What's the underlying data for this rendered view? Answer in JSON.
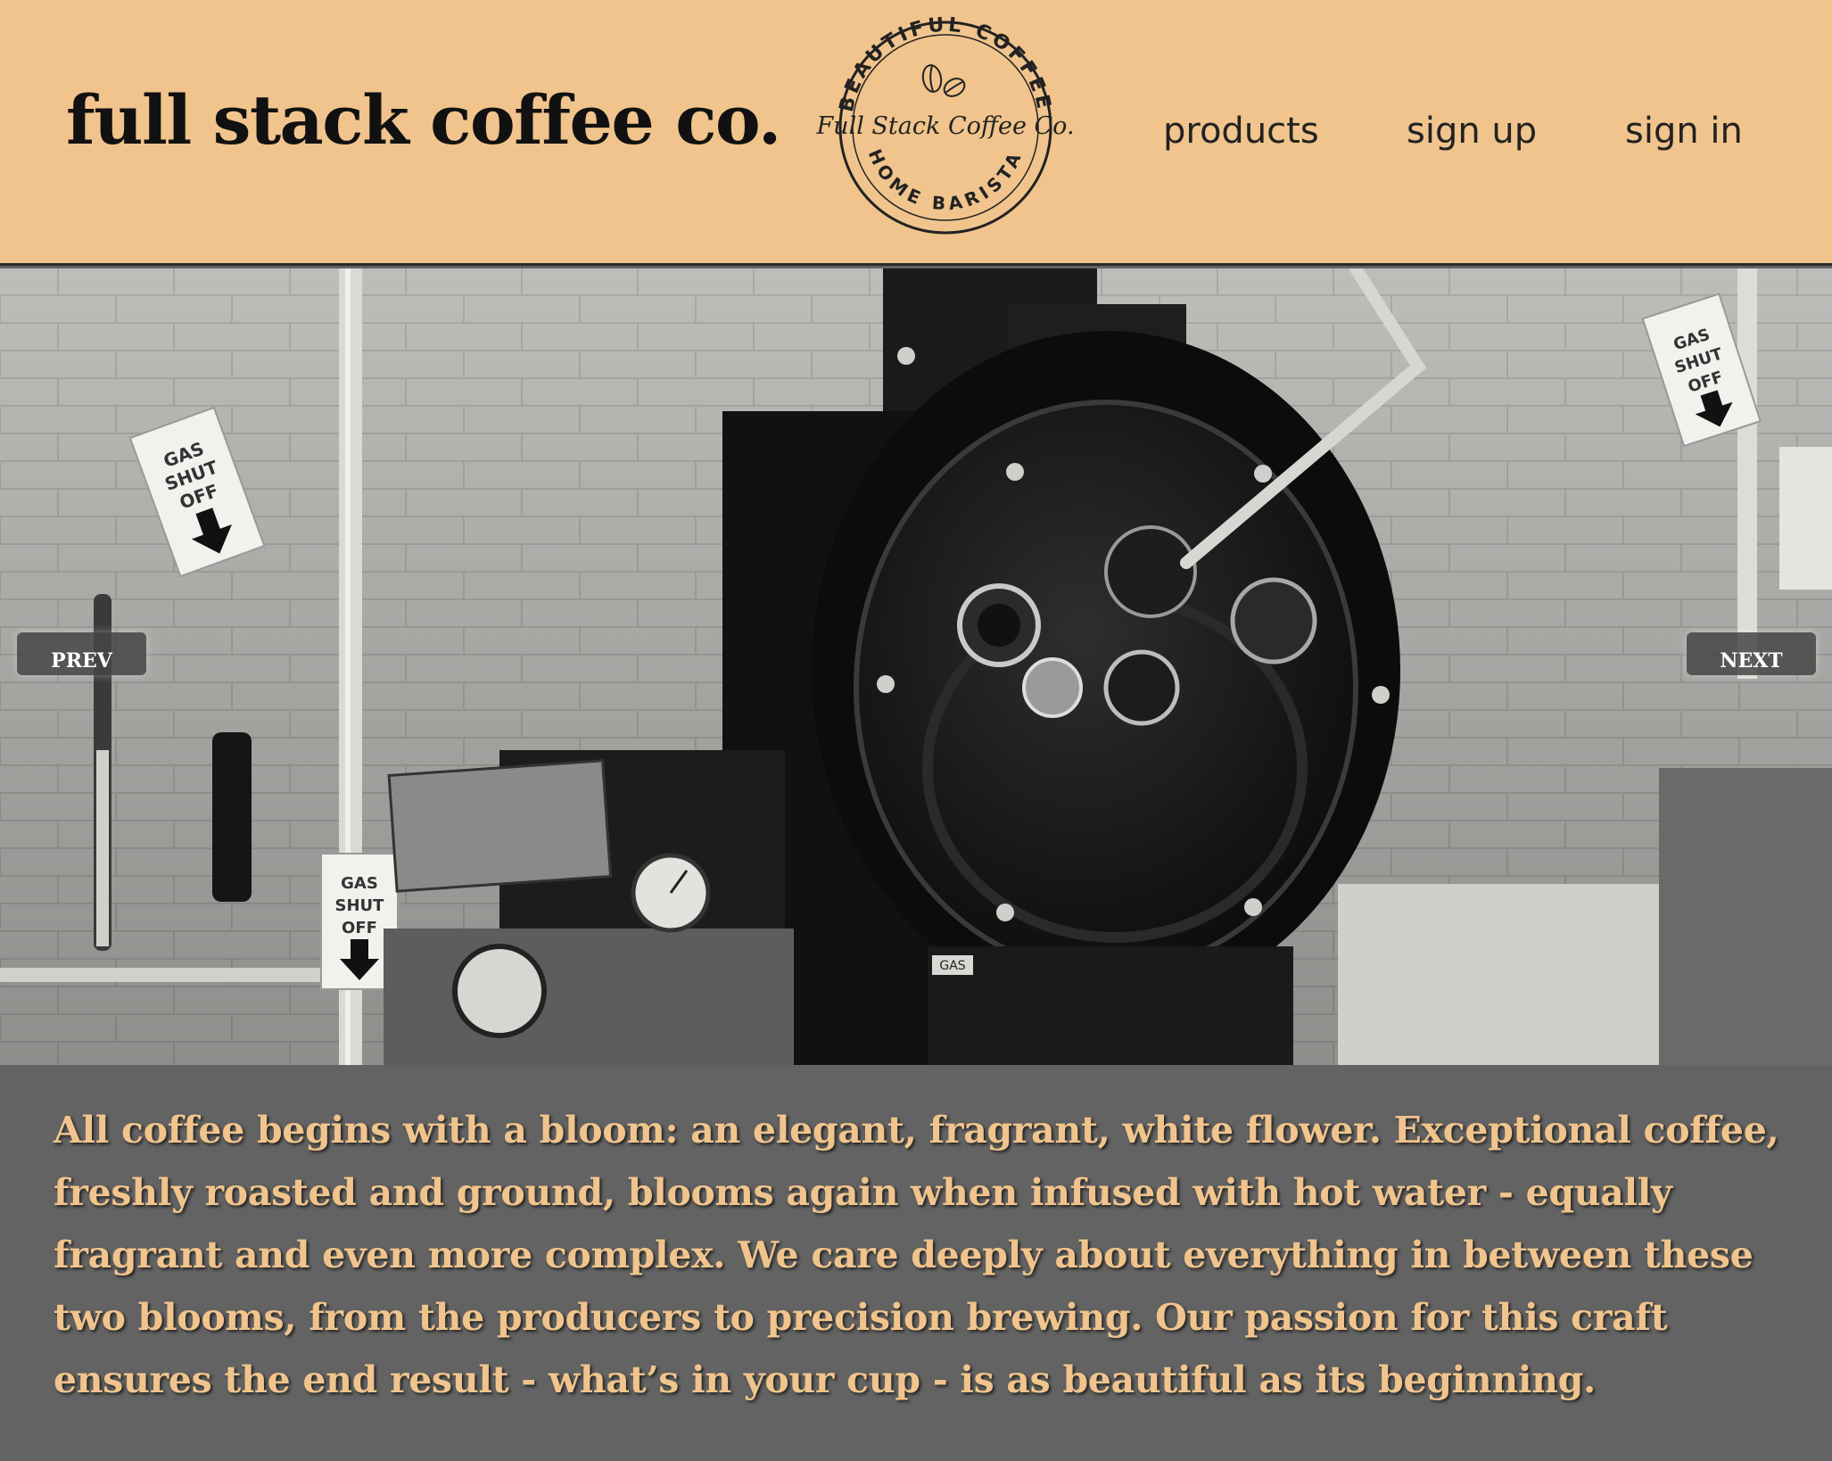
{
  "header": {
    "brand": "full stack coffee co.",
    "logo": {
      "top_text": "BEAUTIFUL COFFEE",
      "center_text": "Full Stack Coffee Co.",
      "bottom_text": "HOME BARISTA"
    },
    "nav": {
      "products": "products",
      "sign_up": "sign up",
      "sign_in": "sign in"
    }
  },
  "carousel": {
    "prev_label": "PREV",
    "next_label": "NEXT",
    "sign_text": [
      "GAS",
      "SHUT",
      "OFF"
    ],
    "gas_label": "GAS"
  },
  "about": {
    "text": "All coffee begins with a bloom: an elegant, fragrant, white flower. Exceptional coffee, freshly roasted and ground, blooms again when infused with hot water - equally fragrant and even more complex. We care deeply about everything in between these two blooms, from the producers to precision brewing. Our passion for this craft ensures the end result - what’s in your cup - is as beautiful as its beginning."
  },
  "colors": {
    "header_bg": "#f0c48c",
    "text_accent": "#f0c48c",
    "about_bg": "#636363"
  }
}
